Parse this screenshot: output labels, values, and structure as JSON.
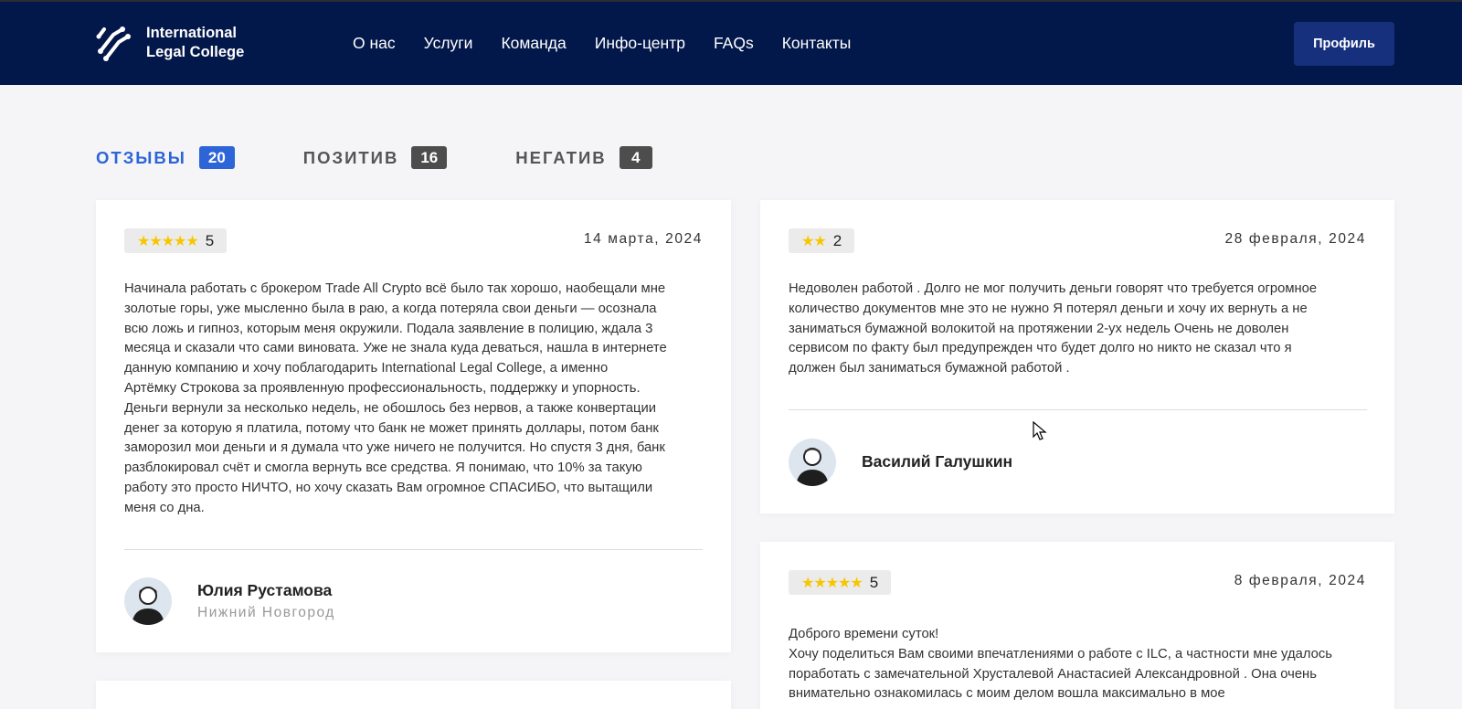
{
  "header": {
    "logo_line1": "International",
    "logo_line2": "Legal College",
    "nav": [
      "О нас",
      "Услуги",
      "Команда",
      "Инфо-центр",
      "FAQs",
      "Контакты"
    ],
    "profile_button": "Профиль"
  },
  "tabs": [
    {
      "label": "ОТЗЫВЫ",
      "count": "20",
      "active": true
    },
    {
      "label": "ПОЗИТИВ",
      "count": "16",
      "active": false
    },
    {
      "label": "НЕГАТИВ",
      "count": "4",
      "active": false
    }
  ],
  "reviews": [
    {
      "stars": "★★★★★",
      "rating": "5",
      "date": "14 марта, 2024",
      "text": "Начинала работать с брокером Trade All Crypto всё было так хорошо, наобещали мне\nзолотые горы, уже мысленно была в раю, а когда потеряла свои деньги — осознала\nвсю ложь и гипноз, которым меня окружили. Подала заявление в полицию, ждала 3\nмесяца и сказали что сами виновата. Уже не знала куда деваться, нашла в интернете\nданную компанию и хочу поблагодарить International Legal College, а именно\nАртёмку Строкова за проявленную профессиональность, поддержку и упорность.\nДеньги вернули за несколько недель, не обошлось без нервов, а также конвертации\nденег за которую я платила, потому что банк не может принять доллары, потом банк\nзаморозил мои деньги и я думала что уже ничего не получится. Но спустя 3 дня, банк\nразблокировал счёт и смогла вернуть все средства. Я понимаю, что 10% за такую\nработу это просто НИЧТО, но хочу сказать Вам огромное СПАСИБО, что вытащили\nменя со дна.",
      "author": "Юлия Рустамова",
      "city": "Нижний Новгород"
    },
    {
      "stars": "★★",
      "rating": "2",
      "date": "28 февраля, 2024",
      "text": "Недоволен работой . Долго не мог получить деньги говорят что требуется огромное\nколичество документов мне это не нужно Я потерял деньги и хочу их вернуть а не\nзаниматься бумажной волокитой на протяжении 2-ух недель Очень не доволен\nсервисом по факту был предупрежден что будет долго но никто не сказал что я\nдолжен был заниматься бумажной работой .",
      "author": "Василий Галушкин"
    },
    {
      "stars": "★★★★★",
      "rating": "5",
      "date": "8 февраля, 2024",
      "text": "Доброго времени суток!\nХочу поделиться Вам своими впечатлениями о работе с ILC, а частности мне удалось\nпоработать с замечательной Хрусталевой Анастасией Александровной . Она очень\nвнимательно ознакомилась с моим делом вошла максимально в мое"
    }
  ],
  "colors": {
    "header_bg": "#03184a",
    "accent": "#2d64d8",
    "star": "#f7c600",
    "page_bg": "#f5f5f7"
  }
}
